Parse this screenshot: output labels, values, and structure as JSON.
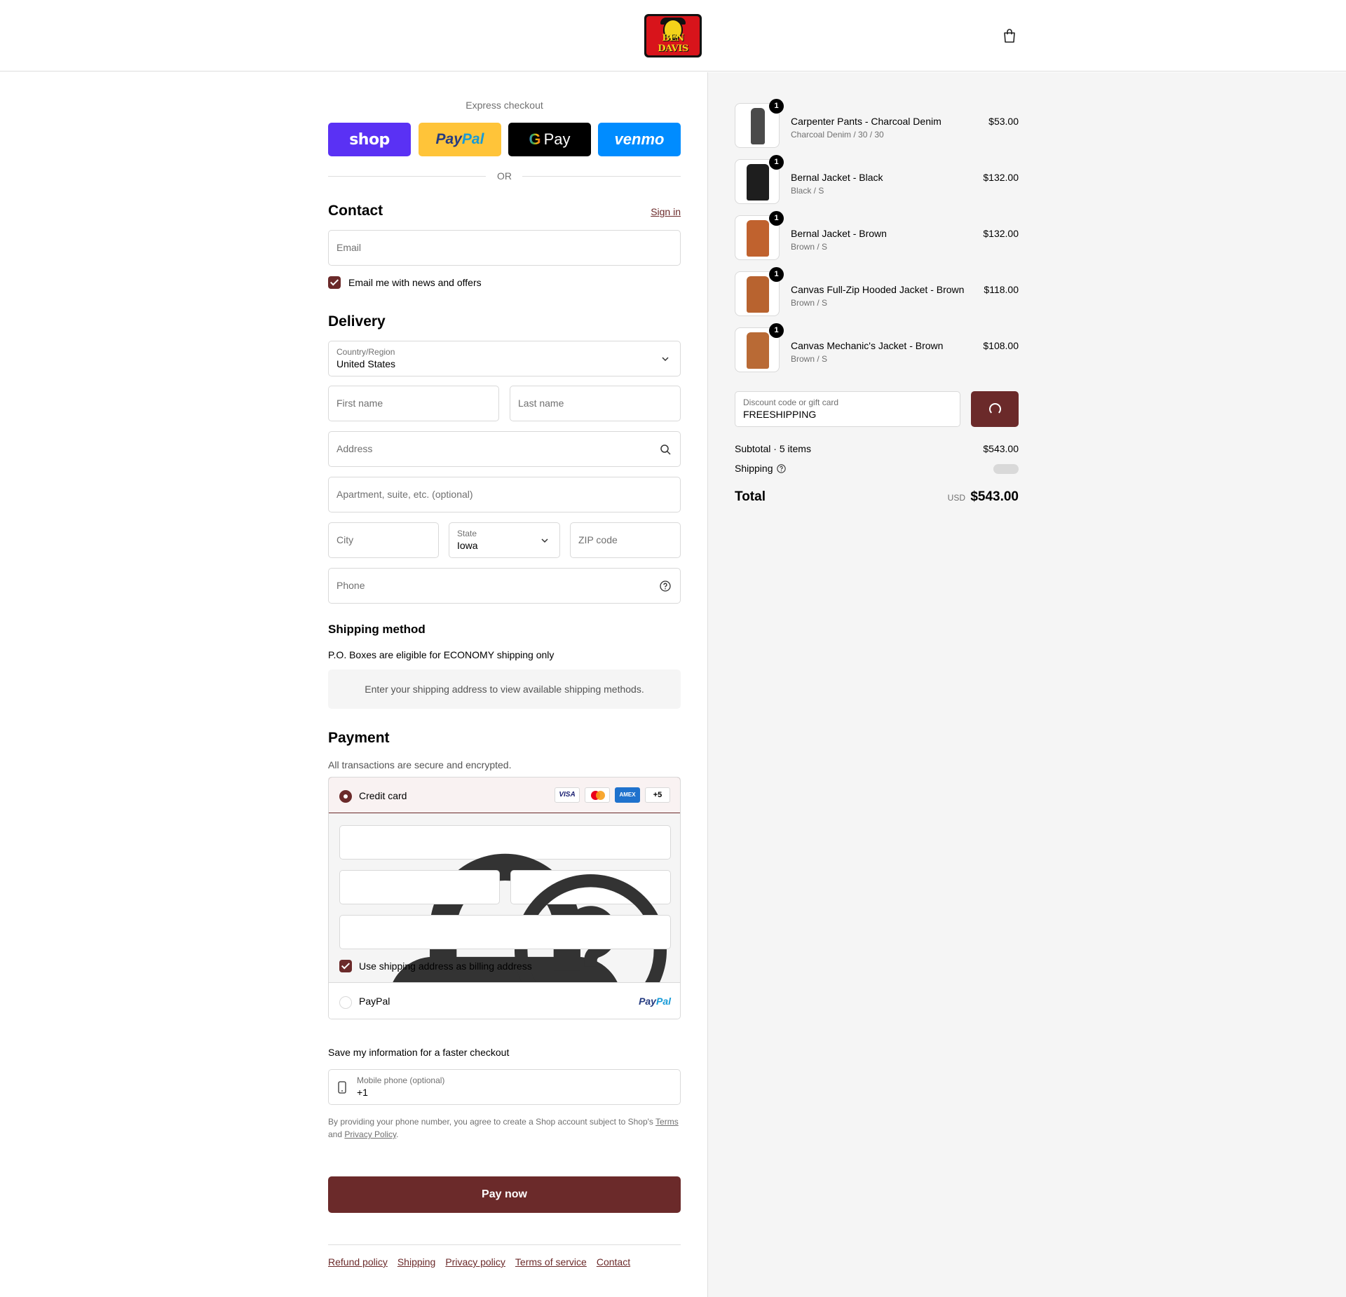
{
  "brand": {
    "name": "BEN DAVIS"
  },
  "express": {
    "title": "Express checkout",
    "shop_label": "shop",
    "paypal_label_a": "Pay",
    "paypal_label_b": "Pal",
    "gpay_g": "G",
    "gpay_label": "Pay",
    "venmo_label": "venmo",
    "or_label": "OR"
  },
  "contact": {
    "title": "Contact",
    "sign_in": "Sign in",
    "email_placeholder": "Email",
    "newsletter_label": "Email me with news and offers"
  },
  "delivery": {
    "title": "Delivery",
    "country_label": "Country/Region",
    "country_value": "United States",
    "first_name": "First name",
    "last_name": "Last name",
    "address": "Address",
    "apartment": "Apartment, suite, etc. (optional)",
    "city": "City",
    "state_label": "State",
    "state_value": "Iowa",
    "zip": "ZIP code",
    "phone": "Phone"
  },
  "shipping_method": {
    "title": "Shipping method",
    "note": "P.O. Boxes are eligible for ECONOMY shipping only",
    "empty_message": "Enter your shipping address to view available shipping methods."
  },
  "payment": {
    "title": "Payment",
    "subtitle": "All transactions are secure and encrypted.",
    "credit_card_label": "Credit card",
    "card_visa": "VISA",
    "card_amex": "AMEX",
    "card_more": "+5",
    "billing_label": "Use shipping address as billing address",
    "paypal_label": "PayPal",
    "paypal_logo_a": "Pay",
    "paypal_logo_b": "Pal"
  },
  "save_info": {
    "title": "Save my information for a faster checkout",
    "mobile_label": "Mobile phone (optional)",
    "mobile_value": "+1",
    "legal_text": "By providing your phone number, you agree to create a Shop account subject to Shop's",
    "terms": "Terms",
    "and": "and",
    "privacy": "Privacy Policy",
    "period": "."
  },
  "pay_now": "Pay now",
  "footer": {
    "links": [
      "Refund policy",
      "Shipping",
      "Privacy policy",
      "Terms of service",
      "Contact"
    ]
  },
  "order": {
    "items": [
      {
        "name": "Carpenter Pants - Charcoal Denim",
        "variant": "Charcoal Denim / 30 / 30",
        "price": "$53.00",
        "qty": "1",
        "color": "#4a4a4a"
      },
      {
        "name": "Bernal Jacket - Black",
        "variant": "Black / S",
        "price": "$132.00",
        "qty": "1",
        "color": "#1e1e1e"
      },
      {
        "name": "Bernal Jacket - Brown",
        "variant": "Brown / S",
        "price": "$132.00",
        "qty": "1",
        "color": "#c0622e"
      },
      {
        "name": "Canvas Full-Zip Hooded Jacket - Brown",
        "variant": "Brown / S",
        "price": "$118.00",
        "qty": "1",
        "color": "#b8632f"
      },
      {
        "name": "Canvas Mechanic's Jacket - Brown",
        "variant": "Brown / S",
        "price": "$108.00",
        "qty": "1",
        "color": "#b96a35"
      }
    ],
    "discount_label": "Discount code or gift card",
    "discount_value": "FREESHIPPING",
    "subtotal_label": "Subtotal · 5 items",
    "subtotal_value": "$543.00",
    "shipping_label": "Shipping",
    "total_label": "Total",
    "currency": "USD",
    "total_value": "$543.00"
  },
  "colors": {
    "accent": "#6b2a2a",
    "panel": "#f5f5f5"
  }
}
